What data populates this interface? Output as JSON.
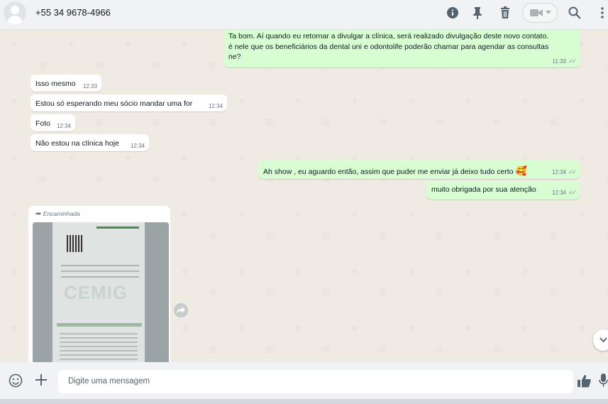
{
  "header": {
    "contact": "+55 34 9678-4966"
  },
  "messages": [
    {
      "dir": "out",
      "text": "Ta bom. Aí quando eu retornar a divulgar a clínica, será realizado divulgação deste novo contato.",
      "text2": "é nele que os beneficiários da dental uni e odontolife poderão chamar para agendar as consultas",
      "text3": "ne?",
      "time": "11:33"
    },
    {
      "dir": "in",
      "text": "Isso mesmo",
      "time": "12:33"
    },
    {
      "dir": "in",
      "text": "Estou só esperando meu sócio mandar uma for",
      "time": "12:34"
    },
    {
      "dir": "in",
      "text": "Foto",
      "time": "12:34"
    },
    {
      "dir": "in",
      "text": "Não estou na clínica hoje",
      "time": "12:34"
    },
    {
      "dir": "out",
      "text": "Ah show , eu aguardo então, assim que puder me enviar já deixo tudo certo",
      "emoji": "🥰",
      "time": "12:34"
    },
    {
      "dir": "out",
      "text": "muito obrigada por sua atenção",
      "time": "12:34"
    }
  ],
  "forwarded": {
    "label": "Encaminhada",
    "image_text": "CEMIG"
  },
  "composer": {
    "placeholder": "Digite uma mensagem"
  },
  "icons": {
    "info": "info-icon",
    "pin": "pin-icon",
    "delete": "trash-icon",
    "video": "video-call-icon",
    "search": "search-icon",
    "menu": "menu-icon",
    "emoji": "emoji-icon",
    "attach": "plus-icon",
    "like": "thumbs-up-icon",
    "mic": "microphone-icon"
  }
}
